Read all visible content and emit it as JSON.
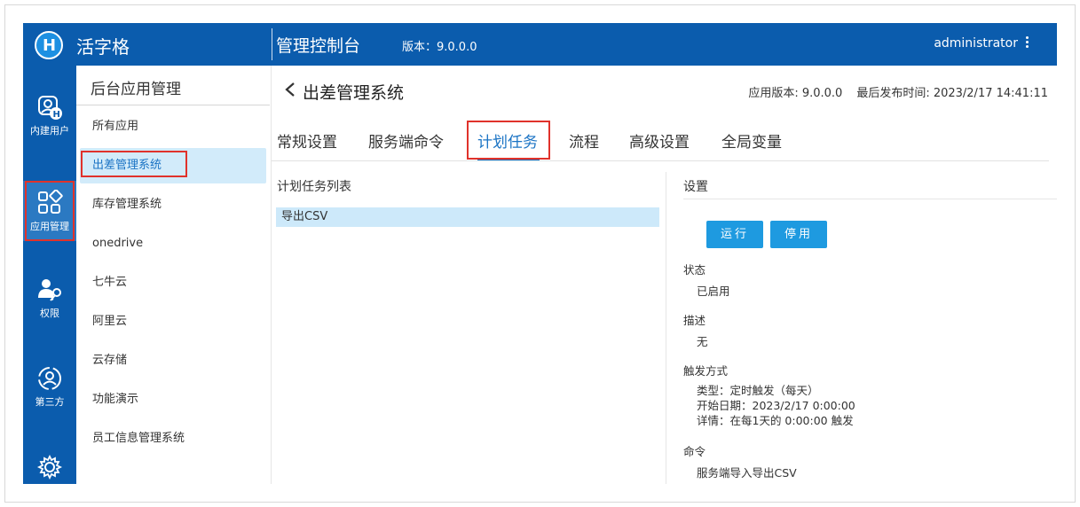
{
  "header": {
    "brand": "活字格",
    "console_title": "管理控制台",
    "version": "版本：9.0.0.0",
    "user": "administrator"
  },
  "rail": [
    {
      "label": "内建用户",
      "icon": "user-badge-icon"
    },
    {
      "label": "应用管理",
      "icon": "apps-grid-icon"
    },
    {
      "label": "权限",
      "icon": "user-key-icon"
    },
    {
      "label": "第三方",
      "icon": "third-party-icon"
    },
    {
      "label": "",
      "icon": "gear-icon"
    }
  ],
  "sidebar": {
    "title": "后台应用管理",
    "items": [
      {
        "label": "所有应用"
      },
      {
        "label": "出差管理系统"
      },
      {
        "label": "库存管理系统"
      },
      {
        "label": "onedrive"
      },
      {
        "label": "七牛云"
      },
      {
        "label": "阿里云"
      },
      {
        "label": "云存储"
      },
      {
        "label": "功能演示"
      },
      {
        "label": "员工信息管理系统"
      }
    ]
  },
  "main": {
    "title": "出差管理系统",
    "app_version": "应用版本: 9.0.0.0",
    "last_published": "最后发布时间: 2023/2/17 14:41:11",
    "tabs": [
      {
        "label": "常规设置"
      },
      {
        "label": "服务端命令"
      },
      {
        "label": "计划任务"
      },
      {
        "label": "流程"
      },
      {
        "label": "高级设置"
      },
      {
        "label": "全局变量"
      }
    ],
    "list_title": "计划任务列表",
    "list_items": [
      {
        "label": "导出CSV"
      }
    ],
    "settings": {
      "title": "设置",
      "run_button": "运行",
      "disable_button": "停用",
      "status_label": "状态",
      "status_value": "已启用",
      "desc_label": "描述",
      "desc_value": "无",
      "trigger_label": "触发方式",
      "trigger_type": "类型：定时触发（每天）",
      "trigger_start": "开始日期：2023/2/17 0:00:00",
      "trigger_detail": "详情：在每1天的 0:00:00 触发",
      "command_label": "命令",
      "command_value": "服务端导入导出CSV"
    }
  },
  "colors": {
    "primary": "#0b5cad",
    "accent": "#1e9ae0",
    "selected_bg": "#d2ebfa",
    "highlight_box": "#e0322b"
  }
}
